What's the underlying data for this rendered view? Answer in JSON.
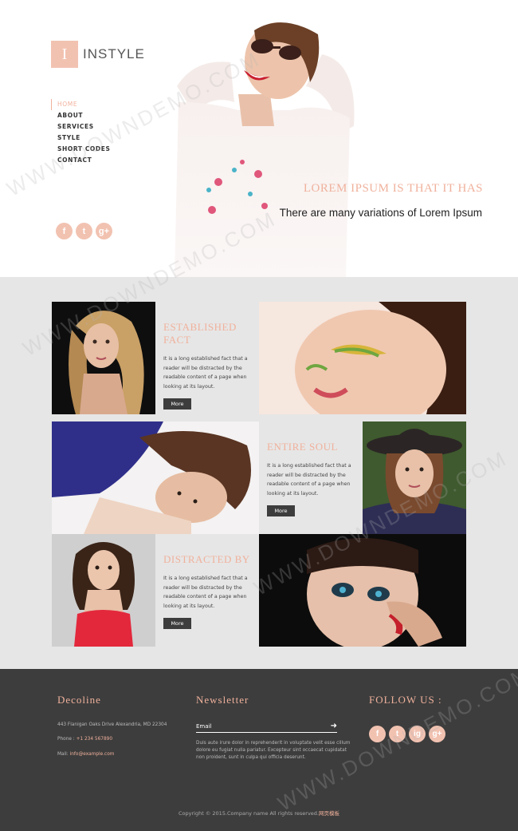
{
  "brand": {
    "logo_letter": "I",
    "name": "INSTYLE"
  },
  "nav": [
    "HOME",
    "ABOUT",
    "SERVICES",
    "STYLE",
    "SHORT CODES",
    "CONTACT"
  ],
  "social_header": [
    "f",
    "t",
    "g+"
  ],
  "hero": {
    "title": "LOREM IPSUM IS THAT IT HAS",
    "subtitle": "There are many variations of Lorem Ipsum"
  },
  "gallery": {
    "blocks": [
      {
        "title": "ESTABLISHED FACT",
        "text": "It is a long established fact that a reader will be distracted by the readable content of a page when looking at its layout.",
        "button": "More"
      },
      {
        "title": "ENTIRE SOUL",
        "text": "It is a long established fact that a reader will be distracted by the readable content of a page when looking at its layout.",
        "button": "More"
      },
      {
        "title": "DISTRACTED BY",
        "text": "It is a long established fact that a reader will be distracted by the readable content of a page when looking at its layout.",
        "button": "More"
      }
    ]
  },
  "footer": {
    "col1": {
      "heading": "Decoline",
      "address": "443 Flanigan Oaks Drive Alexandria, MD 22304",
      "phone_label": "Phone :",
      "phone": "+1 234 567890",
      "mail_label": "Mail:",
      "mail": "info@example.com"
    },
    "col2": {
      "heading": "Newsletter",
      "email_placeholder": "Email",
      "text": "Duis aute irure dolor in reprehenderit in voluptate velit esse cillum dolore eu fugiat nulla pariatur. Excepteur sint occaecat cupidatat non proident, sunt in culpa qui officia deserunt."
    },
    "col3": {
      "heading": "FOLLOW US :",
      "social": [
        "f",
        "t",
        "ig",
        "g+"
      ]
    },
    "copyright": "Copyright © 2015.Company name All rights reserved.",
    "copyright_link": "网页模板"
  },
  "watermark": "WWW.DOWNDEMO.COM",
  "colors": {
    "accent": "#f0b19c",
    "dark": "#3d3d3d",
    "gallery_bg": "#e6e6e6"
  }
}
